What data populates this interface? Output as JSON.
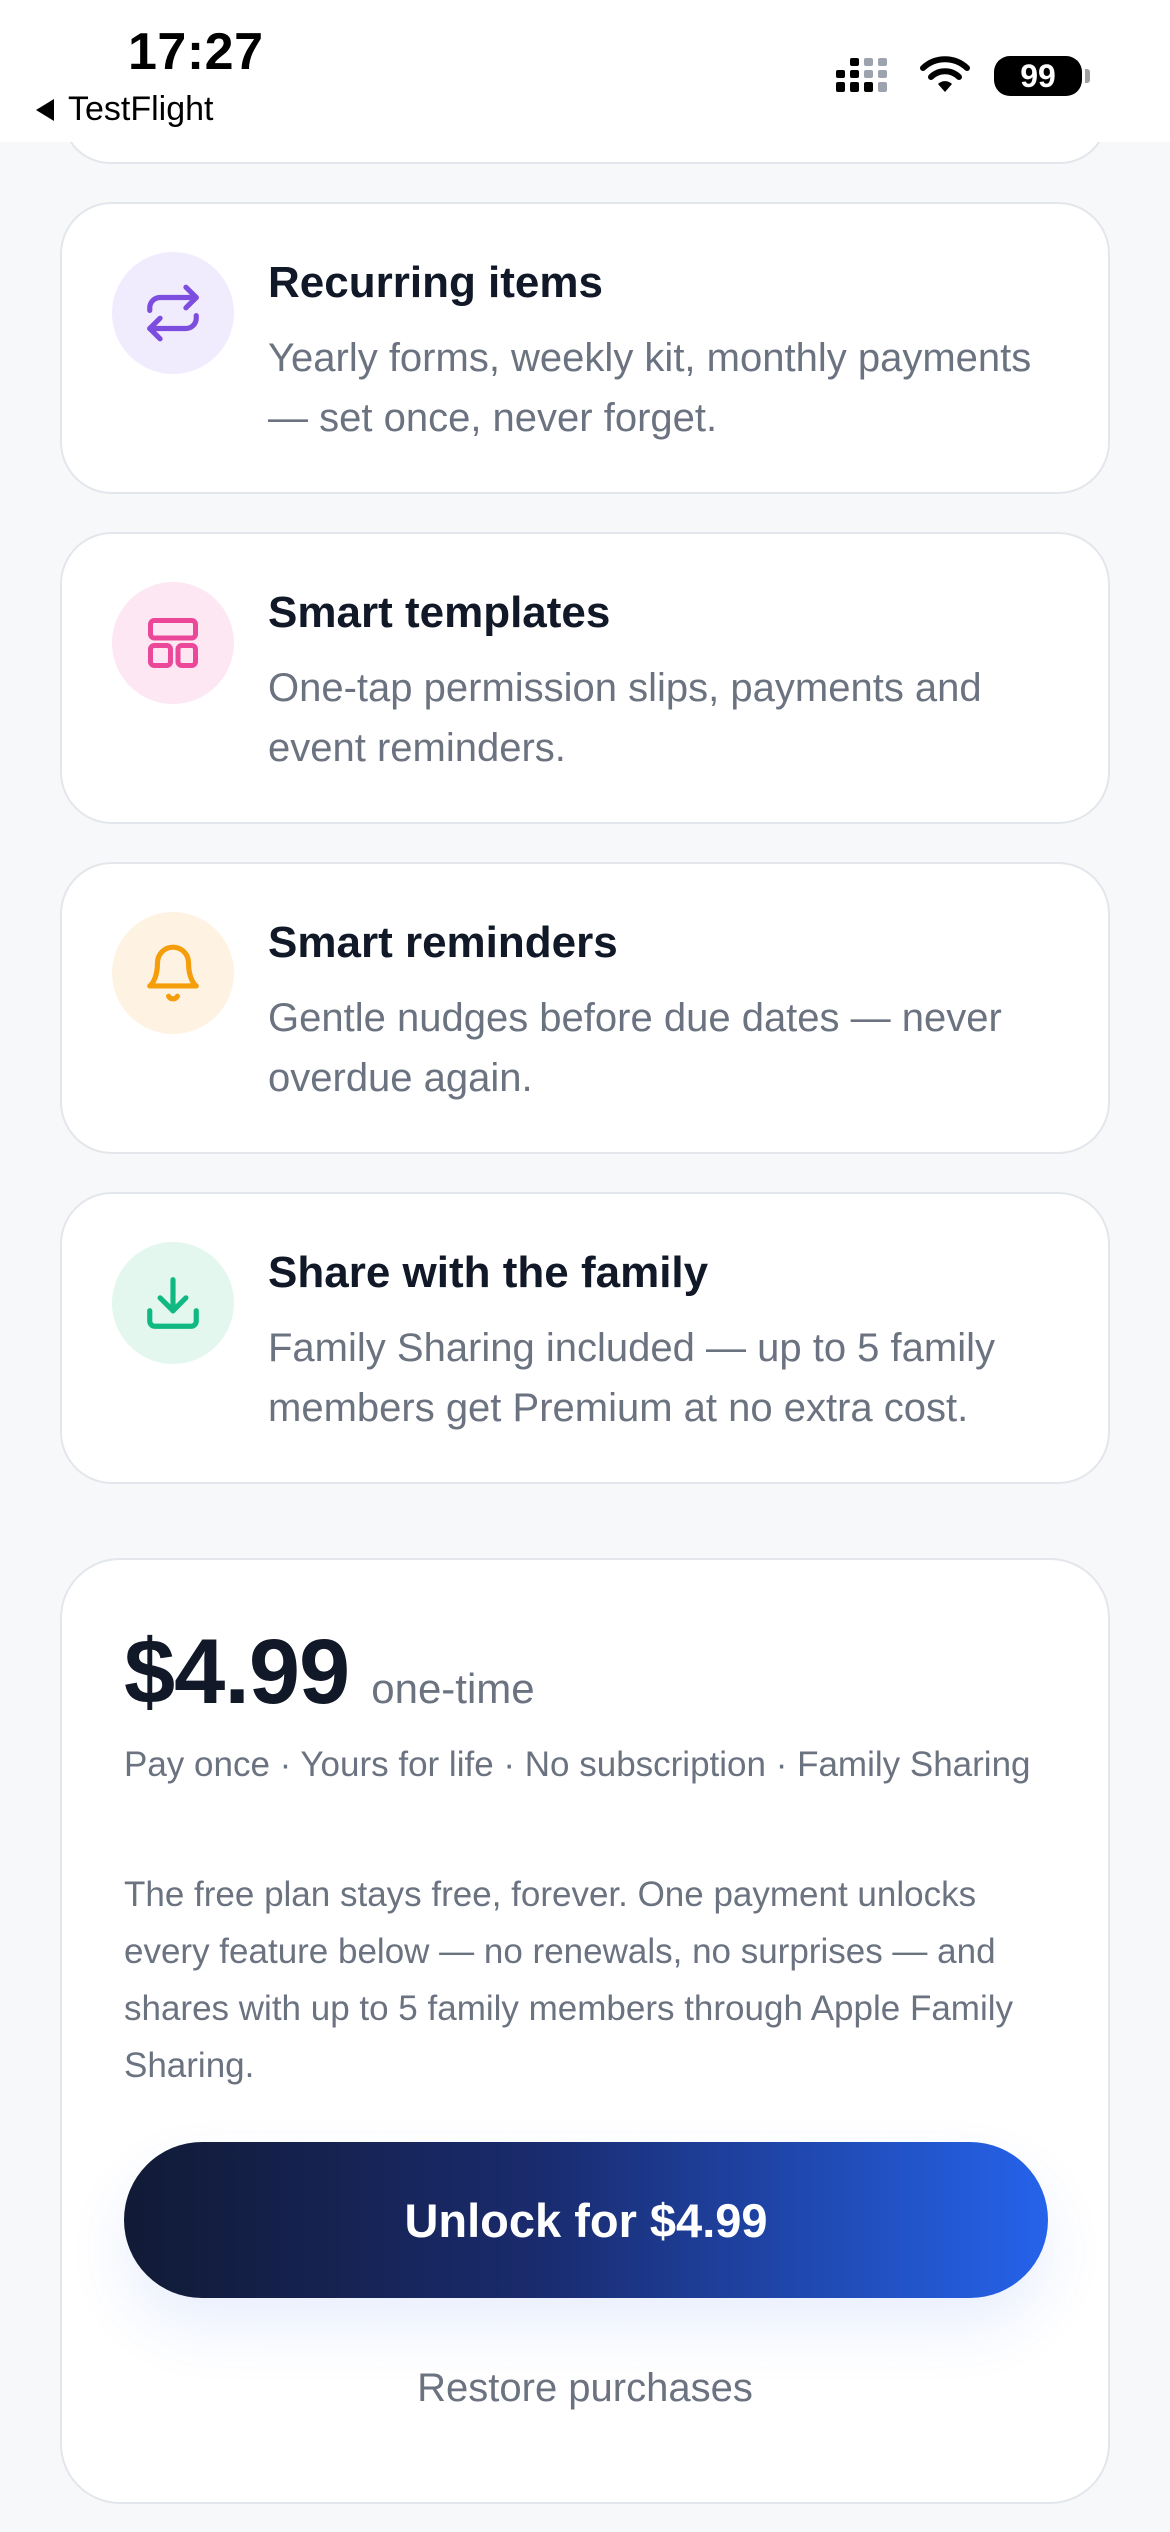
{
  "status_bar": {
    "time": "17:27",
    "back_app": "TestFlight",
    "battery": "99"
  },
  "features": [
    {
      "title": "Recurring items",
      "description": "Yearly forms, weekly kit, monthly payments — set once, never forget.",
      "icon": "repeat-icon",
      "icon_color": "#7c4dde",
      "icon_bg": "#f1ecfd"
    },
    {
      "title": "Smart templates",
      "description": "One-tap permission slips, payments and event reminders.",
      "icon": "template-icon",
      "icon_color": "#ec4899",
      "icon_bg": "#fce7f3"
    },
    {
      "title": "Smart reminders",
      "description": "Gentle nudges before due dates — never overdue again.",
      "icon": "bell-icon",
      "icon_color": "#f59e0b",
      "icon_bg": "#fef3e2"
    },
    {
      "title": "Share with the family",
      "description": "Family Sharing included — up to 5 family members get Premium at no extra cost.",
      "icon": "download-icon",
      "icon_color": "#10b981",
      "icon_bg": "#e3f7ef"
    }
  ],
  "pricing": {
    "price": "$4.99",
    "term": "one-time",
    "tagline": "Pay once · Yours for life · No subscription · Family Sharing",
    "description": "The free plan stays free, forever. One payment unlocks every feature below — no renewals, no surprises — and shares with up to 5 family members through Apple Family Sharing.",
    "button_label": "Unlock for $4.99",
    "restore_label": "Restore purchases"
  },
  "colors": {
    "button_gradient_start": "#111a35",
    "button_gradient_end": "#2563eb",
    "text_primary": "#111827",
    "text_secondary": "#6b7280"
  }
}
